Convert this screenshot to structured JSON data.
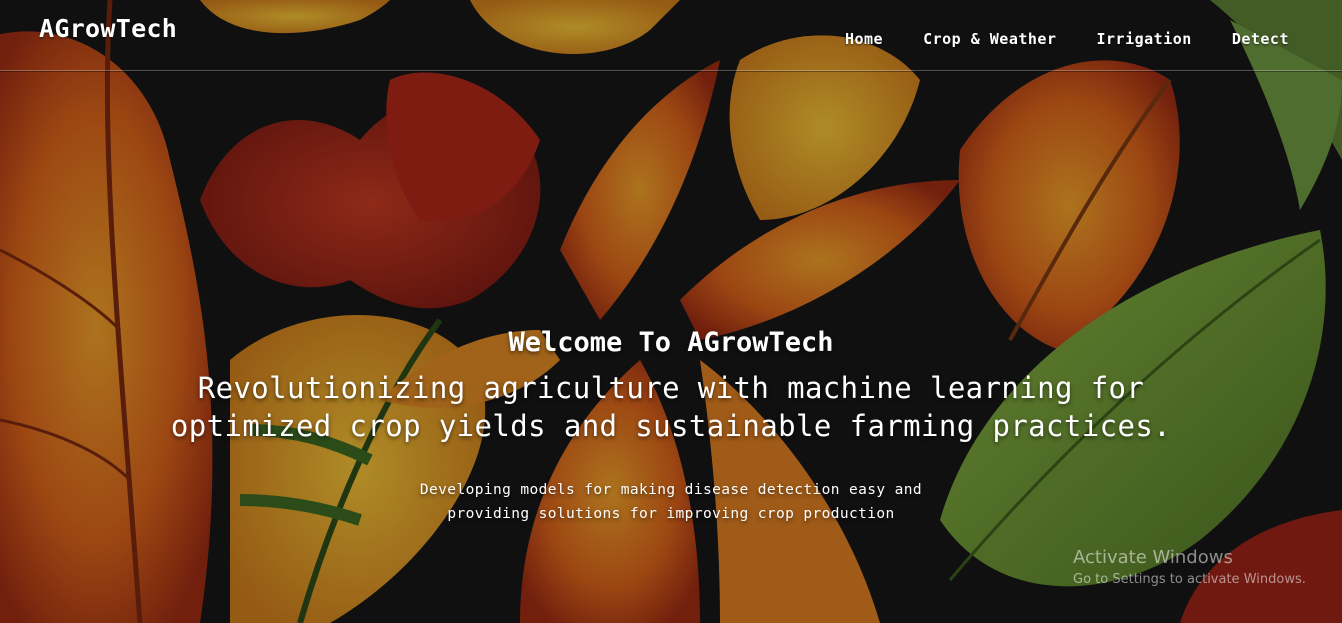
{
  "header": {
    "brand": "AGrowTech",
    "nav": [
      {
        "label": "Home"
      },
      {
        "label": "Crop & Weather"
      },
      {
        "label": "Irrigation"
      },
      {
        "label": "Detect"
      }
    ]
  },
  "hero": {
    "welcome": "Welcome To AGrowTech",
    "tagline": "Revolutionizing agriculture with machine learning for optimized crop yields and sustainable farming practices.",
    "description": "Developing models for making disease detection easy and providing solutions for improving crop production"
  },
  "watermark": {
    "title": "Activate Windows",
    "subtitle": "Go to Settings to activate Windows."
  },
  "colors": {
    "background": "#171717",
    "leaf_red": "#b22a1b",
    "leaf_orange": "#e0781c",
    "leaf_yellow": "#e8b62a",
    "leaf_green": "#6f9a34",
    "text": "#ffffff"
  }
}
